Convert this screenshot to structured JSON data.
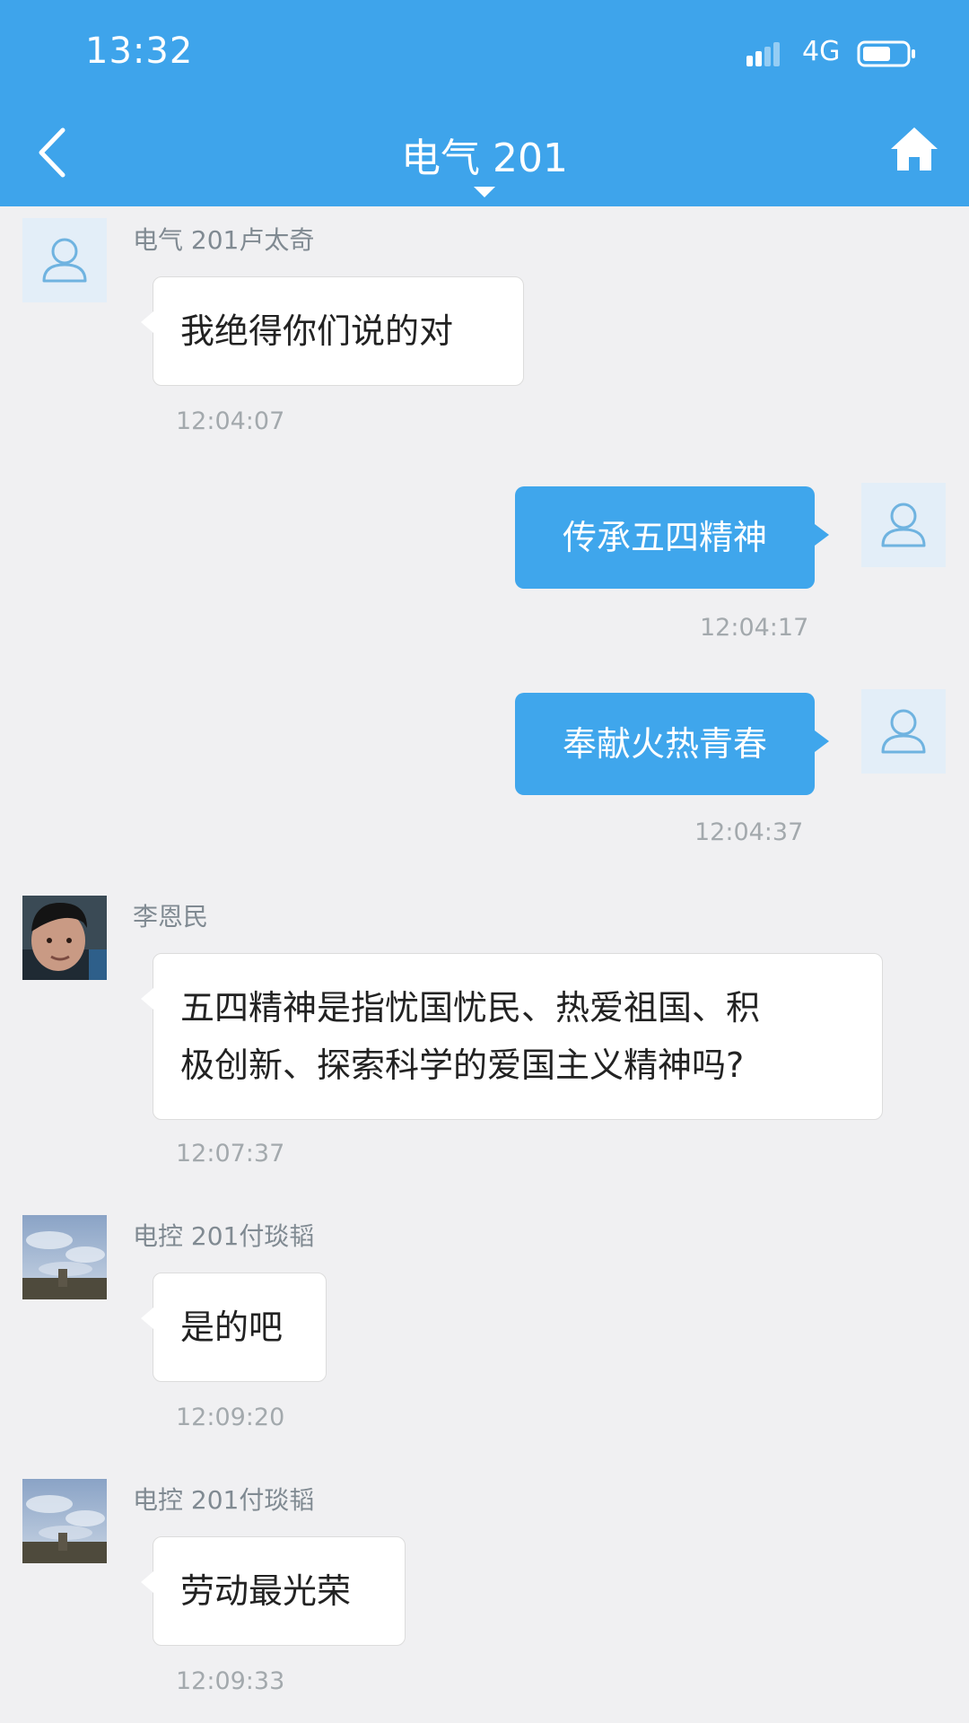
{
  "status_bar": {
    "time": "13:32",
    "network": "4G"
  },
  "header": {
    "title": "电气 201"
  },
  "messages": [
    {
      "sender": "电气 201卢太奇",
      "text": "我绝得你们说的对",
      "time": "12:04:07"
    },
    {
      "text": "传承五四精神",
      "time": "12:04:17"
    },
    {
      "text": "奉献火热青春",
      "time": "12:04:37"
    },
    {
      "sender": "李恩民",
      "text_line1": "五四精神是指忧国忧民、热爱祖国、积",
      "text_line2": "极创新、探索科学的爱国主义精神吗?",
      "time": "12:07:37"
    },
    {
      "sender": "电控 201付琰韬",
      "text": "是的吧",
      "time": "12:09:20"
    },
    {
      "sender": "电控 201付琰韬",
      "text": "劳动最光荣",
      "time": "12:09:33"
    }
  ],
  "colors": {
    "header_bg": "#3ea4eb",
    "outgoing_bubble": "#3fa6ec",
    "page_bg": "#f0f0f2"
  }
}
